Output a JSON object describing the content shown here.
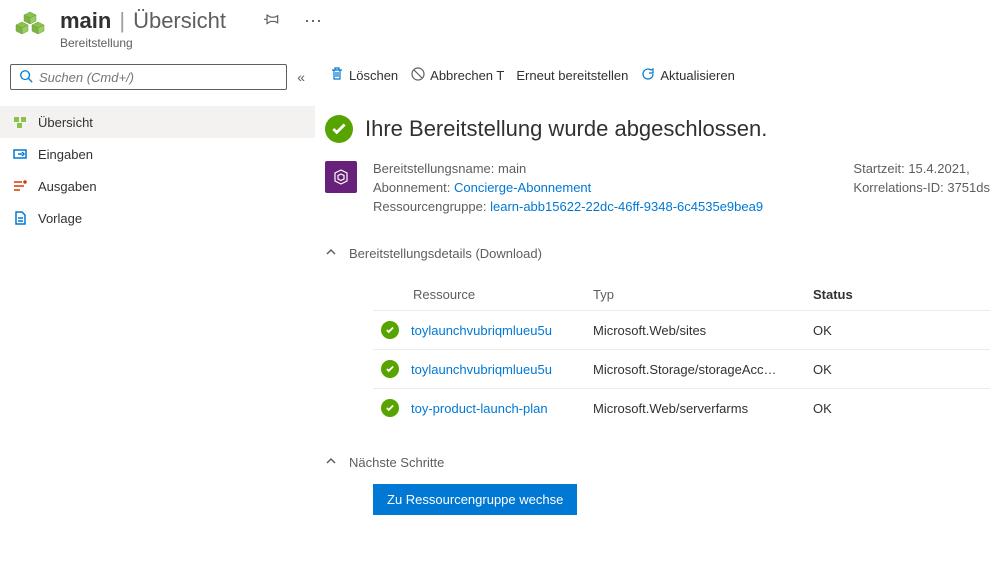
{
  "header": {
    "title": "main",
    "subtitle": "Übersicht",
    "category": "Bereitstellung"
  },
  "search": {
    "placeholder": "Suchen (Cmd+/)"
  },
  "nav": {
    "items": [
      {
        "label": "Übersicht"
      },
      {
        "label": "Eingaben"
      },
      {
        "label": "Ausgaben"
      },
      {
        "label": "Vorlage"
      }
    ]
  },
  "toolbar": {
    "delete": "Löschen",
    "cancel": "Abbrechen T",
    "redeploy": "Erneut bereitstellen",
    "refresh": "Aktualisieren"
  },
  "status": {
    "title": "Ihre Bereitstellung wurde abgeschlossen."
  },
  "info": {
    "name_label": "Bereitstellungsname:",
    "name_value": "main",
    "sub_label": "Abonnement:",
    "sub_value": "Concierge-Abonnement",
    "rg_label": "Ressourcengruppe:",
    "rg_value": "learn-abb15622-22dc-46ff-9348-6c4535e9bea9",
    "start_label": "Startzeit:",
    "start_value": "15.4.2021,",
    "corr_label": "Korrelations-ID:",
    "corr_value": "3751ds"
  },
  "details": {
    "header": "Bereitstellungsdetails (Download)",
    "columns": {
      "resource": "Ressource",
      "type": "Typ",
      "status": "Status"
    },
    "rows": [
      {
        "resource": "toylaunchvubriqmlueu5u",
        "type": "Microsoft.Web/sites",
        "status": "OK"
      },
      {
        "resource": "toylaunchvubriqmlueu5u",
        "type": "Microsoft.Storage/storageAcc…",
        "status": "OK"
      },
      {
        "resource": "toy-product-launch-plan",
        "type": "Microsoft.Web/serverfarms",
        "status": "OK"
      }
    ]
  },
  "next_steps": {
    "header": "Nächste Schritte",
    "button": "Zu Ressourcengruppe wechse"
  }
}
